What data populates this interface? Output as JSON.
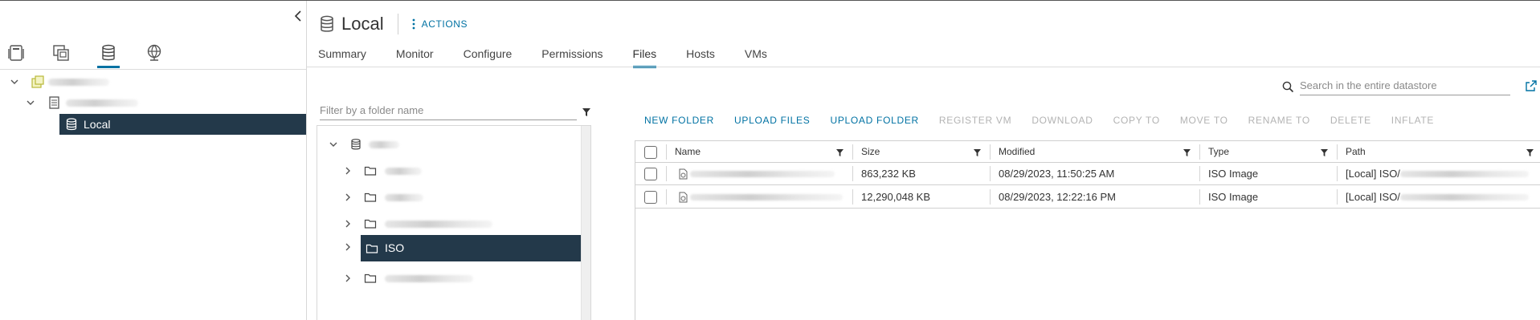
{
  "nav": {
    "tabs": [
      {
        "name": "hosts-clusters",
        "icon": "hosts-and-clusters-icon",
        "active": false
      },
      {
        "name": "vms-templates",
        "icon": "vms-and-templates-icon",
        "active": false
      },
      {
        "name": "storage",
        "icon": "storage-icon",
        "active": true
      },
      {
        "name": "networking",
        "icon": "networking-icon",
        "active": false
      }
    ],
    "selected_label": "Local"
  },
  "header": {
    "title": "Local",
    "actions_label": "ACTIONS"
  },
  "tabs": [
    "Summary",
    "Monitor",
    "Configure",
    "Permissions",
    "Files",
    "Hosts",
    "VMs"
  ],
  "active_tab": "Files",
  "search": {
    "placeholder": "Search in the entire datastore"
  },
  "folder_filter": {
    "placeholder": "Filter by a folder name"
  },
  "folder_tree": {
    "selected_label": "ISO"
  },
  "toolbar": {
    "new_folder": "NEW FOLDER",
    "upload_files": "UPLOAD FILES",
    "upload_folder": "UPLOAD FOLDER",
    "register_vm": "REGISTER VM",
    "download": "DOWNLOAD",
    "copy_to": "COPY TO",
    "move_to": "MOVE TO",
    "rename_to": "RENAME TO",
    "delete": "DELETE",
    "inflate": "INFLATE"
  },
  "grid": {
    "columns": {
      "name": "Name",
      "size": "Size",
      "modified": "Modified",
      "type": "Type",
      "path": "Path"
    },
    "rows": [
      {
        "size": "863,232 KB",
        "modified": "08/29/2023, 11:50:25 AM",
        "type": "ISO Image",
        "path": "[Local] ISO/"
      },
      {
        "size": "12,290,048 KB",
        "modified": "08/29/2023, 12:22:16 PM",
        "type": "ISO Image",
        "path": "[Local] ISO/"
      }
    ]
  },
  "colors": {
    "accent": "#0072a3",
    "selection": "#23394a"
  }
}
